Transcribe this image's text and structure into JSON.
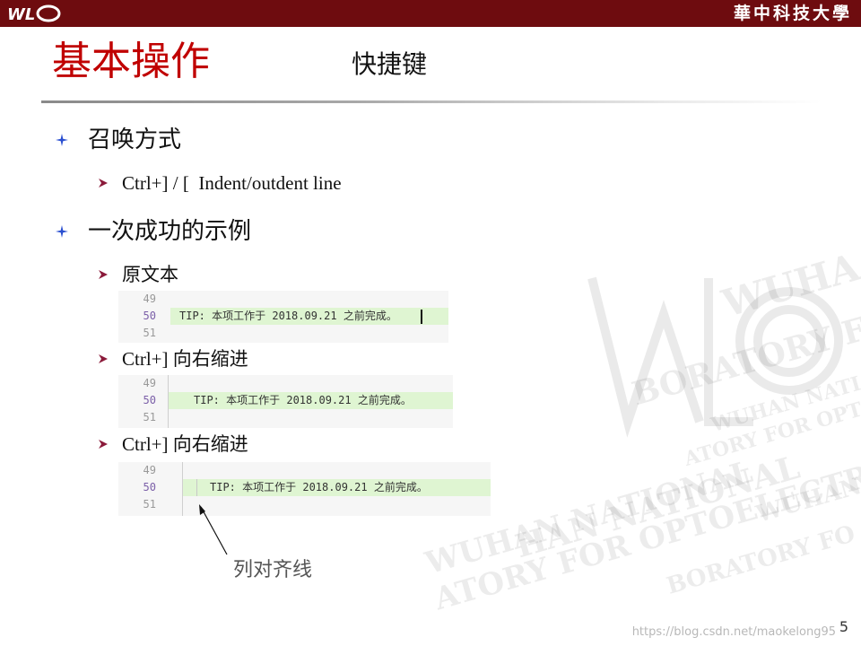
{
  "header": {
    "logo_text": "WLO",
    "university": "華中科技大學"
  },
  "slide": {
    "title": "基本操作",
    "subtitle": "快捷键"
  },
  "watermark": {
    "lines": [
      "WUHA",
      "BORATORY F",
      "WUHAN NATI",
      "ATORY FOR OPT",
      "HAN NATIONAL",
      "WUHAN NATIONAL",
      "ATORY FOR OPTOELECTR",
      "WUHAN",
      "BORATORY FO"
    ]
  },
  "sections": [
    {
      "heading": "召唤方式",
      "items": [
        {
          "label_latin": "Ctrl+] / [  Indent/outdent line"
        }
      ]
    },
    {
      "heading": "一次成功的示例",
      "items": [
        {
          "label_cjk": "原文本"
        },
        {
          "label_latin": "Ctrl+] ",
          "label_cjk": "向右缩进"
        },
        {
          "label_latin": "Ctrl+] ",
          "label_cjk": "向右缩进"
        }
      ]
    }
  ],
  "snippets": [
    {
      "lines": [
        "49",
        "50",
        "51"
      ],
      "current_line": "50",
      "code": "TIP: 本项工作于 2018.09.21 之前完成。",
      "indent_level": 0
    },
    {
      "lines": [
        "49",
        "50",
        "51"
      ],
      "current_line": "50",
      "code": "TIP: 本项工作于 2018.09.21 之前完成。",
      "indent_level": 1
    },
    {
      "lines": [
        "49",
        "50",
        "51"
      ],
      "current_line": "50",
      "code": "TIP: 本项工作于 2018.09.21 之前完成。",
      "indent_level": 2
    }
  ],
  "annotation": "列对齐线",
  "page_number": "5",
  "footer_url": "https://blog.csdn.net/maokelong95",
  "colors": {
    "topbar": "#6e0c0f",
    "title": "#c00000",
    "highlight": "#dff5d2",
    "star_bullet": "#2a4fd0",
    "arrow_bullet": "#8b1a3a"
  }
}
